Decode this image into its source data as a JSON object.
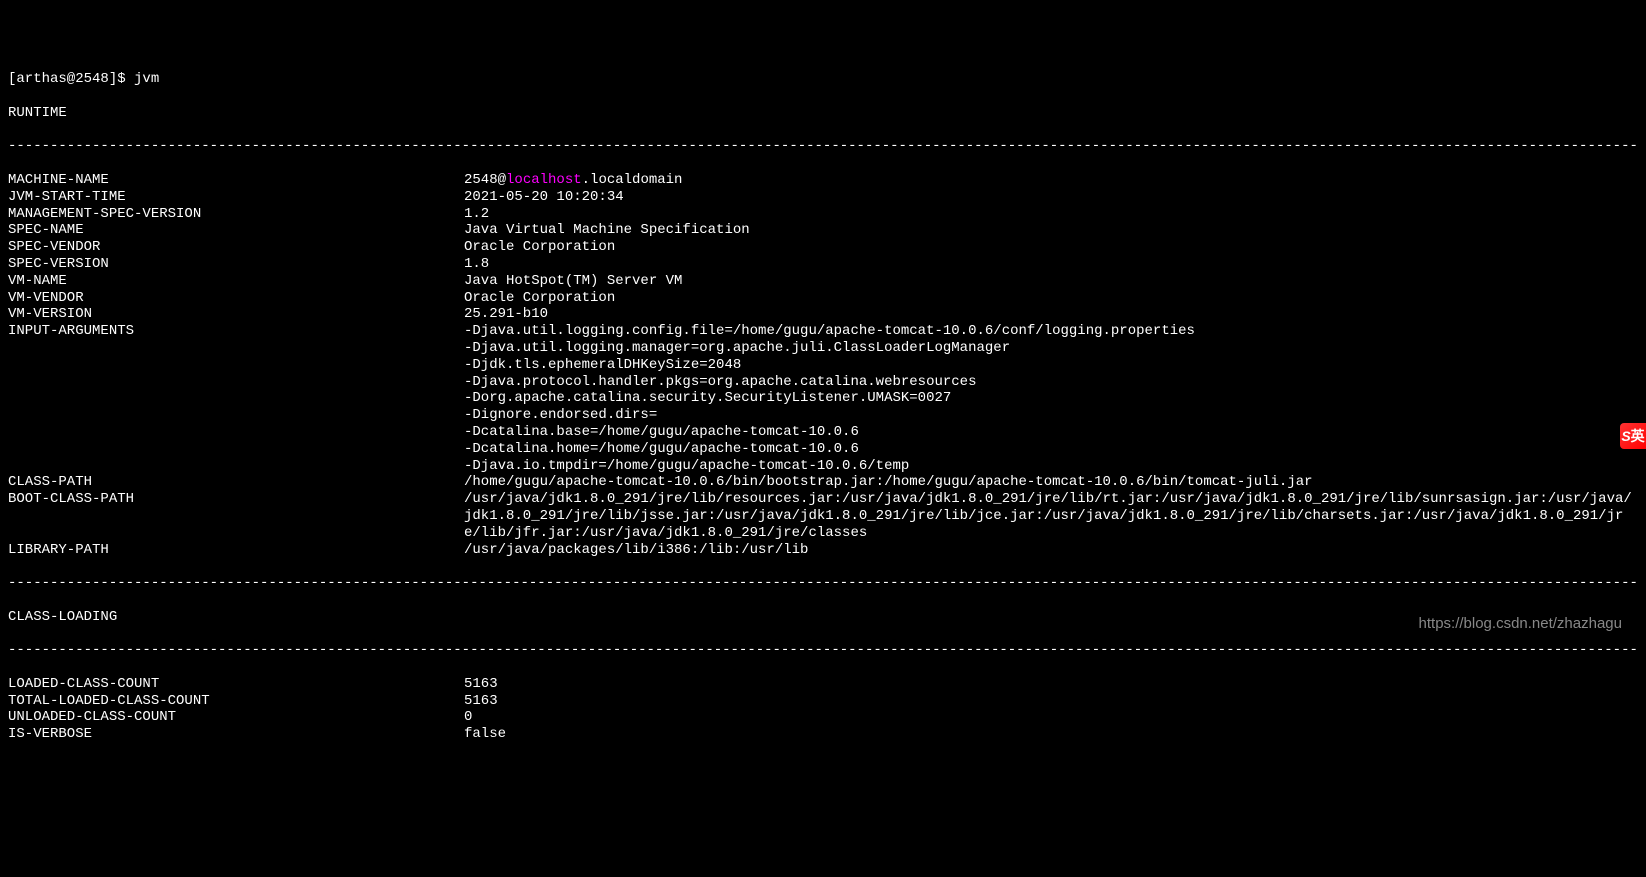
{
  "prompt": {
    "prefix": "[arthas@2548]$ ",
    "command": "jvm"
  },
  "sections": [
    {
      "title": "RUNTIME",
      "rows": [
        {
          "label": "MACHINE-NAME",
          "value": {
            "type": "hostname",
            "prefix": "2548@",
            "host": "localhost",
            "suffix": ".localdomain"
          }
        },
        {
          "label": "JVM-START-TIME",
          "value": "2021-05-20 10:20:34"
        },
        {
          "label": "MANAGEMENT-SPEC-VERSION",
          "value": "1.2"
        },
        {
          "label": "SPEC-NAME",
          "value": "Java Virtual Machine Specification"
        },
        {
          "label": "SPEC-VENDOR",
          "value": "Oracle Corporation"
        },
        {
          "label": "SPEC-VERSION",
          "value": "1.8"
        },
        {
          "label": "VM-NAME",
          "value": "Java HotSpot(TM) Server VM"
        },
        {
          "label": "VM-VENDOR",
          "value": "Oracle Corporation"
        },
        {
          "label": "VM-VERSION",
          "value": "25.291-b10"
        },
        {
          "label": "INPUT-ARGUMENTS",
          "value": {
            "type": "multiline",
            "lines": [
              "-Djava.util.logging.config.file=/home/gugu/apache-tomcat-10.0.6/conf/logging.properties",
              "-Djava.util.logging.manager=org.apache.juli.ClassLoaderLogManager",
              "-Djdk.tls.ephemeralDHKeySize=2048",
              "-Djava.protocol.handler.pkgs=org.apache.catalina.webresources",
              "-Dorg.apache.catalina.security.SecurityListener.UMASK=0027",
              "-Dignore.endorsed.dirs=",
              "-Dcatalina.base=/home/gugu/apache-tomcat-10.0.6",
              "-Dcatalina.home=/home/gugu/apache-tomcat-10.0.6",
              "-Djava.io.tmpdir=/home/gugu/apache-tomcat-10.0.6/temp"
            ]
          }
        },
        {
          "label": "",
          "value": ""
        },
        {
          "label": "CLASS-PATH",
          "value": "/home/gugu/apache-tomcat-10.0.6/bin/bootstrap.jar:/home/gugu/apache-tomcat-10.0.6/bin/tomcat-juli.jar"
        },
        {
          "label": "BOOT-CLASS-PATH",
          "value": {
            "type": "wrap",
            "text": "/usr/java/jdk1.8.0_291/jre/lib/resources.jar:/usr/java/jdk1.8.0_291/jre/lib/rt.jar:/usr/java/jdk1.8.0_291/jre/lib/sunrsasign.jar:/usr/java/jdk1.8.0_291/jre/lib/jsse.jar:/usr/java/jdk1.8.0_291/jre/lib/jce.jar:/usr/java/jdk1.8.0_291/jre/lib/charsets.jar:/usr/java/jdk1.8.0_291/jre/lib/jfr.jar:/usr/java/jdk1.8.0_291/jre/classes"
          }
        },
        {
          "label": "LIBRARY-PATH",
          "value": "/usr/java/packages/lib/i386:/lib:/usr/lib"
        }
      ]
    },
    {
      "title": "CLASS-LOADING",
      "rows": [
        {
          "label": "LOADED-CLASS-COUNT",
          "value": "5163"
        },
        {
          "label": "TOTAL-LOADED-CLASS-COUNT",
          "value": "5163"
        },
        {
          "label": "UNLOADED-CLASS-COUNT",
          "value": "0"
        },
        {
          "label": "IS-VERBOSE",
          "value": "false"
        }
      ]
    }
  ],
  "watermark": "https://blog.csdn.net/zhazhagu",
  "divider": "--------------------------------------------------------------------------------------------------------------------------------------------------------------------------------------------------",
  "badge": {
    "s": "S",
    "rest": "英"
  }
}
